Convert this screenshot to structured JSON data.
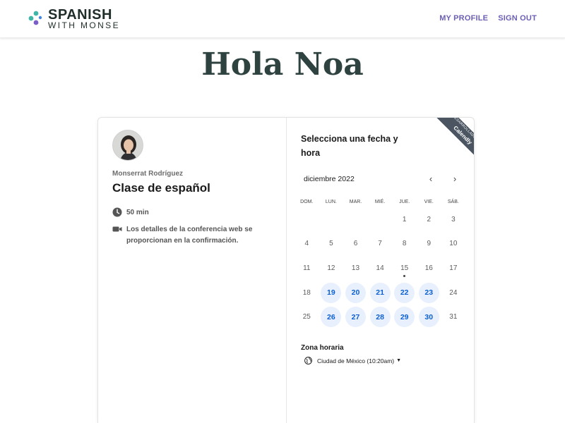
{
  "brand": {
    "name_line1": "SPANISH",
    "name_line2": "WITH MONSE",
    "dot_colors": [
      "#3fb6a8",
      "#7b5fc7",
      "#3f86e6"
    ]
  },
  "nav": {
    "profile": "MY PROFILE",
    "signout": "SIGN OUT"
  },
  "greeting": "Hola Noa",
  "event": {
    "host": "Monserrat Rodríguez",
    "title": "Clase de español",
    "duration_icon": "clock-icon",
    "duration": "50 min",
    "conference_icon": "video-camera-icon",
    "conference": "Los detalles de la conferencia web se proporcionan en la confirmación."
  },
  "calendar": {
    "heading": "Selecciona una fecha y hora",
    "ribbon_small": "DESARROLLADO POR",
    "ribbon_big": "Calendly",
    "month": "diciembre 2022",
    "prev": "‹",
    "next": "›",
    "weekdays": [
      "DOM.",
      "LUN.",
      "MAR.",
      "MIÉ.",
      "JUE.",
      "VIE.",
      "SÁB."
    ],
    "accent": "#0b5fd1",
    "weeks": [
      [
        {
          "d": ""
        },
        {
          "d": ""
        },
        {
          "d": ""
        },
        {
          "d": ""
        },
        {
          "d": "1"
        },
        {
          "d": "2"
        },
        {
          "d": "3"
        }
      ],
      [
        {
          "d": "4"
        },
        {
          "d": "5"
        },
        {
          "d": "6"
        },
        {
          "d": "7"
        },
        {
          "d": "8"
        },
        {
          "d": "9"
        },
        {
          "d": "10"
        }
      ],
      [
        {
          "d": "11"
        },
        {
          "d": "12"
        },
        {
          "d": "13"
        },
        {
          "d": "14"
        },
        {
          "d": "15",
          "today": true
        },
        {
          "d": "16"
        },
        {
          "d": "17"
        }
      ],
      [
        {
          "d": "18"
        },
        {
          "d": "19",
          "available": true
        },
        {
          "d": "20",
          "available": true
        },
        {
          "d": "21",
          "available": true
        },
        {
          "d": "22",
          "available": true
        },
        {
          "d": "23",
          "available": true
        },
        {
          "d": "24"
        }
      ],
      [
        {
          "d": "25"
        },
        {
          "d": "26",
          "available": true
        },
        {
          "d": "27",
          "available": true
        },
        {
          "d": "28",
          "available": true
        },
        {
          "d": "29",
          "available": true
        },
        {
          "d": "30",
          "available": true
        },
        {
          "d": "31"
        }
      ]
    ]
  },
  "timezone": {
    "label": "Zona horaria",
    "value": "Ciudad de México (10:20am)"
  }
}
